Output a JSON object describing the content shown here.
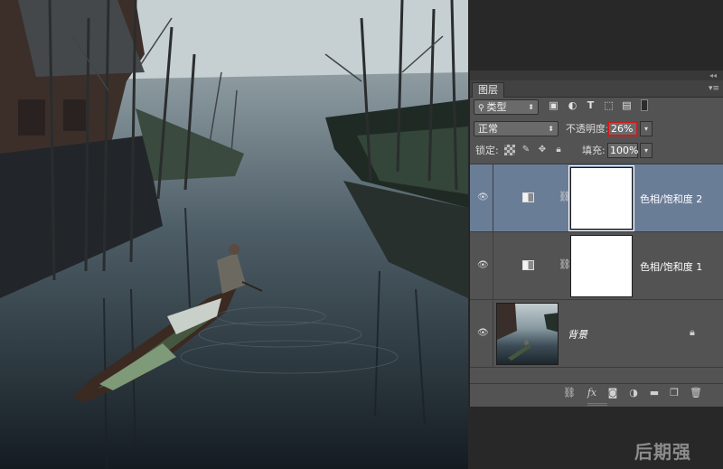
{
  "panel": {
    "tab_label": "图层",
    "collapse_glyph": "◂◂",
    "menu_glyph": "▾≡"
  },
  "filter_row": {
    "kind_label": "类型",
    "icons": [
      "image-filter-icon",
      "adjustment-filter-icon",
      "type-filter-icon",
      "shape-filter-icon",
      "smart-object-filter-icon",
      "filter-toggle-icon"
    ]
  },
  "blend_row": {
    "blend_mode": "正常",
    "opacity_label": "不透明度:",
    "opacity_value": "26%"
  },
  "lock_row": {
    "lock_label": "锁定:",
    "fill_label": "填充:",
    "fill_value": "100%"
  },
  "layers": [
    {
      "name": "色相/饱和度 2",
      "selected": true
    },
    {
      "name": "色相/饱和度 1",
      "selected": false
    },
    {
      "name": "背景",
      "selected": false
    }
  ],
  "watermark": "后期强",
  "colors": {
    "panel_bg": "#535353",
    "selected_layer": "#6a7d97",
    "highlight_box": "#d11a1a"
  }
}
